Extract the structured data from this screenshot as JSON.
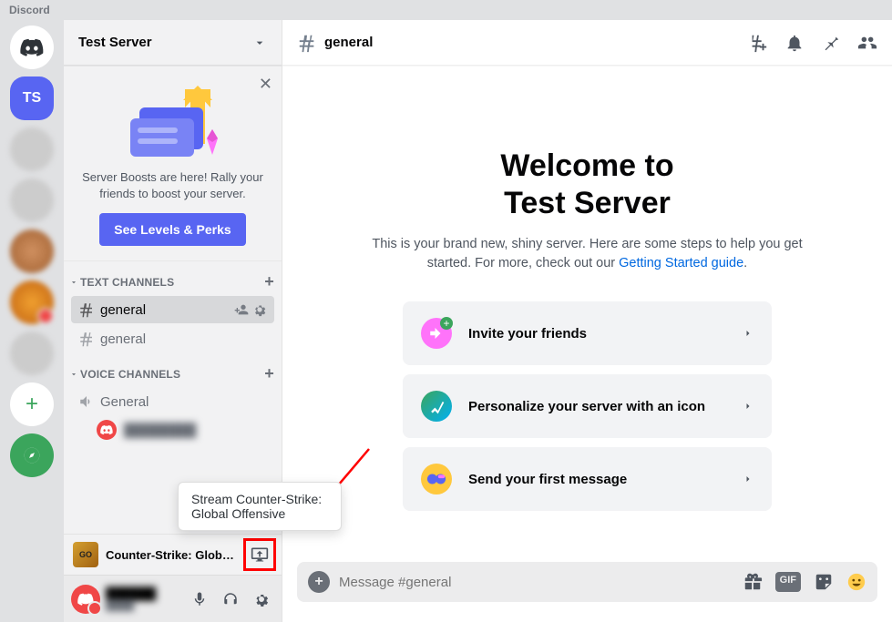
{
  "app_name": "Discord",
  "server_initials": "TS",
  "server_name": "Test Server",
  "boost": {
    "text": "Server Boosts are here! Rally your friends to boost your server.",
    "cta": "See Levels & Perks"
  },
  "sections": {
    "text_label": "TEXT CHANNELS",
    "voice_label": "VOICE CHANNELS"
  },
  "text_channels": [
    {
      "name": "general",
      "selected": true
    },
    {
      "name": "general",
      "selected": false
    }
  ],
  "voice_channels": [
    {
      "name": "General"
    }
  ],
  "activity": {
    "game": "Counter-Strike: Global ...",
    "game_icon_text": "GO",
    "tooltip": "Stream Counter-Strike: Global Offensive"
  },
  "topbar": {
    "channel": "general"
  },
  "welcome": {
    "line1": "Welcome to",
    "line2": "Test Server",
    "desc_pre": "This is your brand new, shiny server. Here are some steps to help you get started. For more, check out our ",
    "link": "Getting Started guide",
    "desc_post": "."
  },
  "cards": [
    {
      "label": "Invite your friends"
    },
    {
      "label": "Personalize your server with an icon"
    },
    {
      "label": "Send your first message"
    }
  ],
  "composer": {
    "placeholder": "Message #general"
  }
}
